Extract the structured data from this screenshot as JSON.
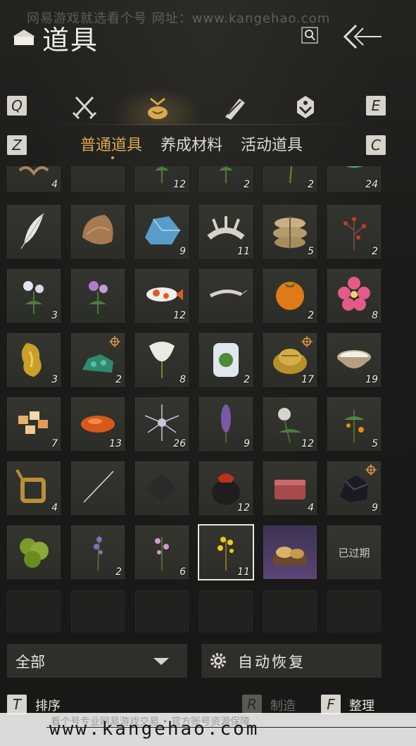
{
  "watermark_top": "网易游戏就选看个号  网址：www.kangehao.com",
  "header": {
    "title": "道具"
  },
  "keys": {
    "q": "Q",
    "e": "E",
    "z": "Z",
    "c": "C",
    "t": "T",
    "r": "R",
    "f": "F"
  },
  "tabs": [
    {
      "icon": "crossed-swords-icon",
      "active": false
    },
    {
      "icon": "pouch-icon",
      "active": true
    },
    {
      "icon": "scroll-icon",
      "active": false
    },
    {
      "icon": "badge-icon",
      "active": false
    }
  ],
  "subtabs": [
    "普通道具",
    "养成材料",
    "活动道具"
  ],
  "items": [
    {
      "icon": "root-icon",
      "count": "4"
    },
    {
      "icon": "purple-herb-icon",
      "count": ""
    },
    {
      "icon": "herb-icon",
      "count": "12"
    },
    {
      "icon": "herb-icon",
      "count": "2"
    },
    {
      "icon": "sprout-icon",
      "count": "2"
    },
    {
      "icon": "jade-icon",
      "count": "24"
    },
    {
      "icon": "feather-icon",
      "count": ""
    },
    {
      "icon": "fur-icon",
      "count": ""
    },
    {
      "icon": "blue-ore-icon",
      "count": "9"
    },
    {
      "icon": "bone-icon",
      "count": "11"
    },
    {
      "icon": "grain-sack-icon",
      "count": "5"
    },
    {
      "icon": "red-berry-branch-icon",
      "count": "2"
    },
    {
      "icon": "white-flower-icon",
      "count": "3"
    },
    {
      "icon": "purple-flower-icon",
      "count": ""
    },
    {
      "icon": "koi-icon",
      "count": "12"
    },
    {
      "icon": "shrimp-icon",
      "count": ""
    },
    {
      "icon": "persimmon-icon",
      "count": "2"
    },
    {
      "icon": "pink-flower-icon",
      "count": "8"
    },
    {
      "icon": "gold-nugget-icon",
      "count": "3"
    },
    {
      "icon": "green-ore-icon",
      "count": "2",
      "tracked": true
    },
    {
      "icon": "white-blossom-icon",
      "count": "8"
    },
    {
      "icon": "jar-plant-icon",
      "count": "2"
    },
    {
      "icon": "gold-ingot-icon",
      "count": "17",
      "tracked": true
    },
    {
      "icon": "milk-bowl-icon",
      "count": "19"
    },
    {
      "icon": "candy-icon",
      "count": "7"
    },
    {
      "icon": "orange-stone-icon",
      "count": "13"
    },
    {
      "icon": "spiky-flower-icon",
      "count": "26"
    },
    {
      "icon": "lavender-icon",
      "count": "9"
    },
    {
      "icon": "white-peony-icon",
      "count": "12"
    },
    {
      "icon": "orange-fruit-branch-icon",
      "count": "5"
    },
    {
      "icon": "bronze-frame-icon",
      "count": "4"
    },
    {
      "icon": "needle-icon",
      "count": ""
    },
    {
      "icon": "spiked-ball-icon",
      "count": ""
    },
    {
      "icon": "wine-jar-icon",
      "count": "12"
    },
    {
      "icon": "meat-icon",
      "count": "4"
    },
    {
      "icon": "black-ore-icon",
      "count": "9",
      "tracked": true
    },
    {
      "icon": "green-shrub-icon",
      "count": ""
    },
    {
      "icon": "purple-sprig-icon",
      "count": "2"
    },
    {
      "icon": "pink-sprig-icon",
      "count": "6"
    },
    {
      "icon": "yellow-flower-branch-icon",
      "count": "11",
      "selected": true
    },
    {
      "icon": "mooncake-tray-icon",
      "count": "",
      "special": "purple"
    },
    {
      "icon": "expired-icon",
      "count": "",
      "expired": "已过期"
    },
    {
      "icon": "",
      "count": "",
      "empty": true
    },
    {
      "icon": "",
      "count": "",
      "empty": true
    },
    {
      "icon": "",
      "count": "",
      "empty": true
    },
    {
      "icon": "",
      "count": "",
      "empty": true
    },
    {
      "icon": "",
      "count": "",
      "empty": true
    },
    {
      "icon": "",
      "count": "",
      "empty": true
    }
  ],
  "filter": {
    "value": "全部"
  },
  "auto_restore": {
    "label": "自动恢复"
  },
  "actions": {
    "sort": "排序",
    "craft": "制造",
    "arrange": "整理"
  },
  "watermark_bottom": {
    "site": "www.kangehao.com",
    "note": "看个号专业网易游戏交易 • 官方账号资源保障"
  },
  "colors": {
    "accent": "#d9a94e",
    "cell_bg": "#30312c",
    "text": "#ece8df"
  }
}
